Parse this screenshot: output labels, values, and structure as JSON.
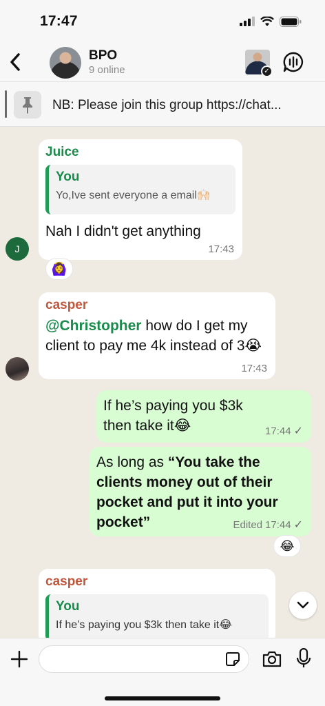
{
  "status_bar": {
    "time": "17:47"
  },
  "header": {
    "title": "BPO",
    "subtitle": "9 online"
  },
  "pinned": {
    "text": "NB: Please join this group https://chat..."
  },
  "messages": [
    {
      "sender": "Juice",
      "quote_name": "You",
      "quote_text": "Yo,Ive sent everyone a email🙌🏻",
      "text": "Nah I didn't get anything",
      "time": "17:43",
      "avatar_letter": "J",
      "reaction": "🙆‍♀️"
    },
    {
      "sender": "casper",
      "mention": "@Christopher",
      "text_after_mention": " how do I get my client to pay me 4k instead of 3😭",
      "time": "17:43"
    },
    {
      "text": "If he’s paying you $3k then take it😂",
      "time": "17:44"
    },
    {
      "prefix": "As long as ",
      "bold_text": "“You take the clients money out of their pocket and put it into your pocket”",
      "edited_label": "Edited",
      "time": "17:44",
      "reaction": "😂"
    },
    {
      "sender": "casper",
      "quote_name": "You",
      "quote_text": "If he’s paying you $3k then take it😂"
    }
  ],
  "composer": {
    "placeholder": ""
  },
  "colors": {
    "incoming_bubble": "#ffffff",
    "outgoing_bubble": "#d9fdd3",
    "accent_green": "#1a8b4c",
    "casper_name": "#c0573b"
  }
}
